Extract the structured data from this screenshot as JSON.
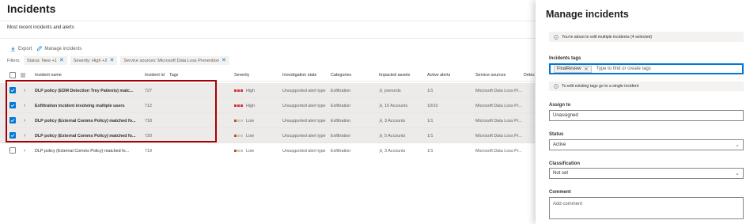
{
  "page": {
    "title": "Incidents",
    "subtitle": "Most recent incidents and alerts"
  },
  "toolbar": {
    "export_label": "Export",
    "manage_label": "Manage incidents"
  },
  "filters": {
    "label": "Filters:",
    "chips": [
      "Status: New +1",
      "Severity: High +2",
      "Service sources: Microsoft Data Loss Prevention"
    ]
  },
  "table": {
    "columns": {
      "name": "Incident name",
      "id": "Incident Id",
      "tags": "Tags",
      "severity": "Severity",
      "investigation": "Investigation state",
      "categories": "Categories",
      "assets": "Impacted assets",
      "alerts": "Active alerts",
      "sources": "Service sources",
      "detection": "Detec"
    },
    "rows": [
      {
        "name": "DLP policy (EDM Detection Trey Patients) matc...",
        "id": "727",
        "severity": "High",
        "investigation": "Unsupported alert type",
        "category": "Exfiltration",
        "assets": "joenords",
        "alerts": "1/1",
        "sources": "Microsoft Data Loss Pr...",
        "selected": true
      },
      {
        "name": "Exfiltration incident involving multiple users",
        "id": "712",
        "severity": "High",
        "investigation": "Unsupported alert type",
        "category": "Exfiltration",
        "assets": "10 Accounts",
        "alerts": "10/10",
        "sources": "Microsoft Data Loss Pr...",
        "selected": true
      },
      {
        "name": "DLP policy (External Comms Policy) matched fo...",
        "id": "718",
        "severity": "Low",
        "investigation": "Unsupported alert type",
        "category": "Exfiltration",
        "assets": "3 Accounts",
        "alerts": "1/1",
        "sources": "Microsoft Data Loss Pr...",
        "selected": true
      },
      {
        "name": "DLP policy (External Comms Policy) matched fo...",
        "id": "720",
        "severity": "Low",
        "investigation": "Unsupported alert type",
        "category": "Exfiltration",
        "assets": "5 Accounts",
        "alerts": "1/1",
        "sources": "Microsoft Data Loss Pr...",
        "selected": true
      },
      {
        "name": "DLP policy (External Comms Policy) matched fo...",
        "id": "719",
        "severity": "Low",
        "investigation": "Unsupported alert type",
        "category": "Exfiltration",
        "assets": "3 Accounts",
        "alerts": "1/1",
        "sources": "Microsoft Data Loss Pr...",
        "selected": false
      }
    ]
  },
  "panel": {
    "title": "Manage incidents",
    "info_text": "You're about to edit multiple incidents (4 selected)",
    "tags_label": "Incidents tags",
    "tag_chip": "FinalReview",
    "tags_placeholder": "Type to find or create tags",
    "tags_info": "To edit existing tags go to a single incident",
    "assign_label": "Assign to",
    "assign_value": "Unassigned",
    "status_label": "Status",
    "status_value": "Active",
    "classification_label": "Classification",
    "classification_value": "Not set",
    "comment_label": "Comment",
    "comment_placeholder": "Add comment"
  },
  "colors": {
    "accent": "#0078d4",
    "severity_high": "#d13438",
    "severity_low": "#ca5010",
    "highlight_box": "#a80000"
  }
}
